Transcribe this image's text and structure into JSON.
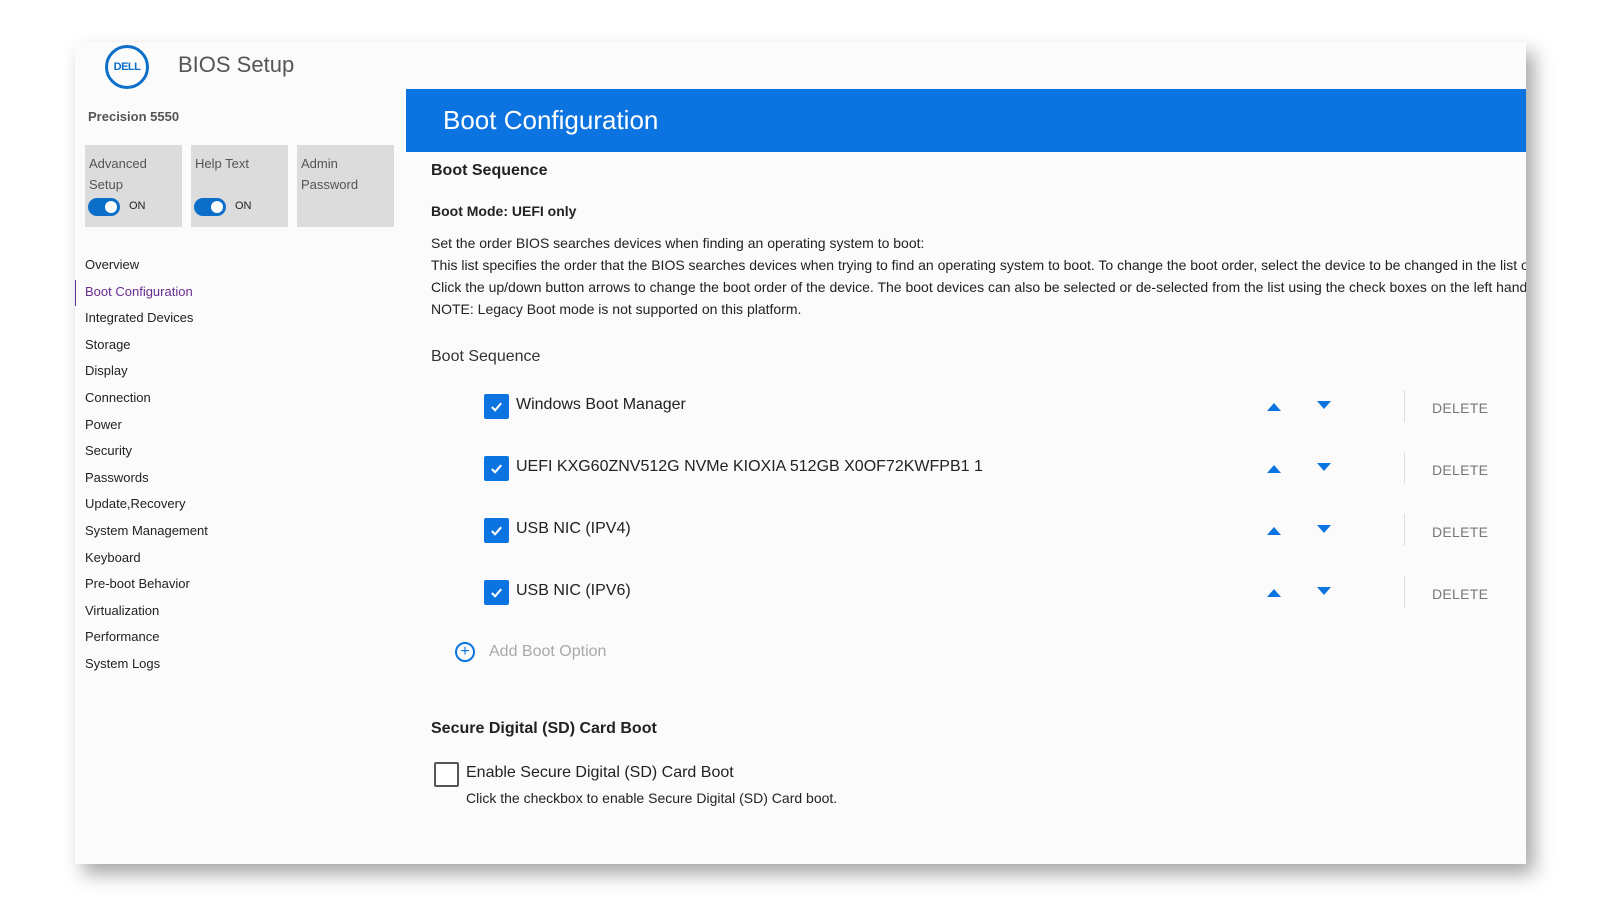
{
  "header": {
    "logo_text": "DELL",
    "app_title": "BIOS Setup",
    "model": "Precision 5550"
  },
  "tiles": [
    {
      "label": "Advanced Setup",
      "toggle_state": "ON",
      "has_toggle": true
    },
    {
      "label": "Help Text",
      "toggle_state": "ON",
      "has_toggle": true
    },
    {
      "label": "Admin Password",
      "has_toggle": false
    }
  ],
  "sidebar": {
    "active": "Boot Configuration",
    "items": [
      {
        "label": "Overview"
      },
      {
        "label": "Boot Configuration"
      },
      {
        "label": "Integrated Devices"
      },
      {
        "label": "Storage"
      },
      {
        "label": "Display"
      },
      {
        "label": "Connection"
      },
      {
        "label": "Power"
      },
      {
        "label": "Security"
      },
      {
        "label": "Passwords"
      },
      {
        "label": "Update,Recovery"
      },
      {
        "label": "System Management"
      },
      {
        "label": "Keyboard"
      },
      {
        "label": "Pre-boot Behavior"
      },
      {
        "label": "Virtualization"
      },
      {
        "label": "Performance"
      },
      {
        "label": "System Logs"
      }
    ]
  },
  "main": {
    "title": "Boot Configuration",
    "section_title": "Boot Sequence",
    "boot_mode": "Boot Mode: UEFI only",
    "description": [
      "Set the order BIOS searches devices when finding an operating system to boot:",
      "This list specifies the order that the BIOS searches devices when trying to find an operating system to boot.  To change the boot order, select the device to be changed in the list o",
      "Click the up/down button arrows to change the boot order of the device.  The boot devices can also be selected or de-selected from the list using the check boxes on the left hand",
      "NOTE: Legacy Boot mode is not supported on this platform."
    ],
    "list_title": "Boot Sequence",
    "boot_options": [
      {
        "label": "Windows Boot Manager",
        "checked": true,
        "delete_label": "DELETE"
      },
      {
        "label": "UEFI KXG60ZNV512G NVMe KIOXIA 512GB X0OF72KWFPB1 1",
        "checked": true,
        "delete_label": "DELETE"
      },
      {
        "label": "USB NIC (IPV4)",
        "checked": true,
        "delete_label": "DELETE"
      },
      {
        "label": "USB NIC (IPV6)",
        "checked": true,
        "delete_label": "DELETE"
      }
    ],
    "add_boot_option": "Add Boot Option",
    "sd": {
      "title": "Secure Digital (SD) Card Boot",
      "checkbox_label": "Enable Secure Digital (SD) Card Boot",
      "checked": false,
      "help": "Click the checkbox to enable Secure Digital (SD) Card boot."
    }
  },
  "colors": {
    "accent": "#0b74e0",
    "active_nav": "#6a2c91",
    "tile_bg": "#dcdcdc"
  }
}
